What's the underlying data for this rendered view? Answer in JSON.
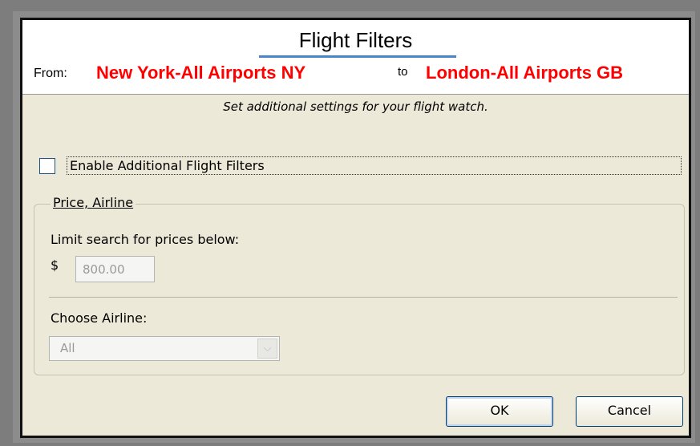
{
  "dialog": {
    "title": "Flight Filters",
    "route": {
      "from_label": "From:",
      "from_city": "New York-All Airports NY",
      "to_label": "to",
      "to_city": "London-All Airports GB"
    },
    "subtitle": "Set additional settings for your flight watch.",
    "enable_filters": {
      "label": "Enable Additional Flight Filters",
      "checked": false
    },
    "price_airline_group": {
      "legend": "Price, Airline",
      "limit_label": "Limit search for prices below:",
      "currency_symbol": "$",
      "price_value": "800.00",
      "airline_label": "Choose Airline:",
      "airline_selected": "All"
    },
    "buttons": {
      "ok": "OK",
      "cancel": "Cancel"
    }
  },
  "colors": {
    "route_text": "#ff0000",
    "dialog_background": "#ece9d8",
    "title_accent": "#4a86c7"
  }
}
